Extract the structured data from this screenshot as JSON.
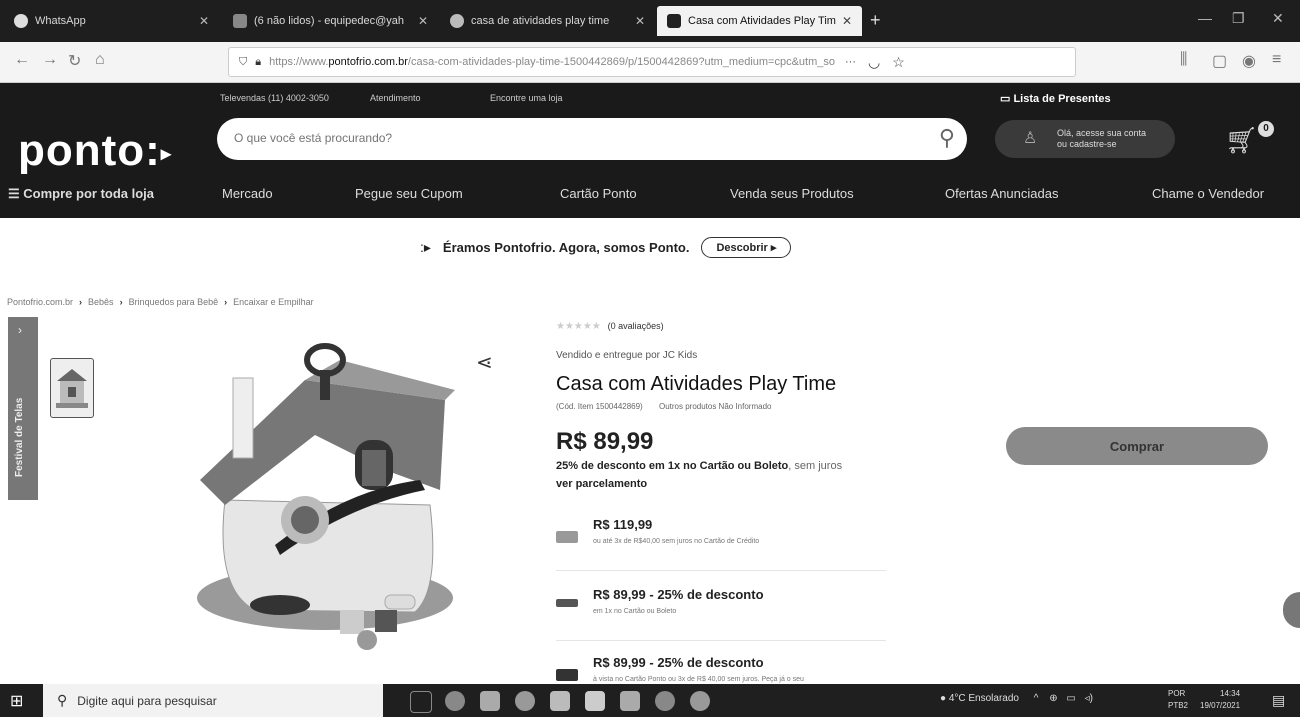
{
  "browser": {
    "tabs": [
      {
        "label": "WhatsApp",
        "icon": "whatsapp-icon",
        "active": false
      },
      {
        "label": "(6 não lidos) - equipedec@yah",
        "icon": "mail-icon",
        "active": false
      },
      {
        "label": "casa de atividades play time",
        "icon": "google-icon",
        "active": false
      },
      {
        "label": "Casa com Atividades Play Tim",
        "icon": "ponto-icon",
        "active": true
      }
    ],
    "url_prefix": "https://www.",
    "url_host": "pontofrio.com.br",
    "url_path": "/casa-com-atividades-play-time-1500442869/p/1500442869?utm_medium=cpc&utm_so",
    "url_more": "···"
  },
  "site": {
    "toplinks": [
      "Televendas (11) 4002-3050",
      "Atendimento",
      "Encontre uma loja"
    ],
    "lista_presentes": "Lista de Presentes",
    "logo": "ponto:",
    "search_placeholder": "O que você está procurando?",
    "account_line1": "Olá, acesse sua conta",
    "account_line2": "ou cadastre-se",
    "cart_count": "0",
    "categories": [
      "Compre por toda loja",
      "Mercado",
      "Pegue seu Cupom",
      "Cartão Ponto",
      "Venda seus Produtos",
      "Ofertas Anunciadas",
      "Chame o Vendedor"
    ]
  },
  "banner": {
    "text": "Éramos Pontofrio. Agora, somos Ponto.",
    "button": "Descobrir ▸"
  },
  "breadcrumb": [
    "Pontofrio.com.br",
    "Bebês",
    "Brinquedos para Bebê",
    "Encaixar e Empilhar"
  ],
  "festival_label": "Festival de Telas",
  "product": {
    "reviews": "(0 avaliações)",
    "seller": "Vendido e entregue por JC Kids",
    "title": "Casa com Atividades Play Time",
    "code": "(Cód. Item 1500442869)",
    "others": "Outros produtos Não Informado",
    "price": "R$ 89,99",
    "discount_bold": "25% de desconto em 1x no Cartão ou Boleto",
    "discount_rest": ", sem juros",
    "parcelamento": "ver parcelamento",
    "buy_button": "Comprar",
    "options": [
      {
        "title": "R$ 119,99",
        "sub": "ou até 3x de R$40,00 sem juros no Cartão de Crédito"
      },
      {
        "title": "R$ 89,99 - 25% de desconto",
        "sub": "em 1x no Cartão ou Boleto"
      },
      {
        "title": "R$ 89,99 - 25% de desconto",
        "sub": "à vista no Cartão Ponto ou 3x de R$ 40,00 sem juros. Peça já o seu"
      }
    ]
  },
  "taskbar": {
    "search_placeholder": "Digite aqui para pesquisar",
    "weather": "4°C  Ensolarado",
    "lang": "POR",
    "lang2": "PTB2",
    "time": "14:34",
    "date": "19/07/2021"
  }
}
